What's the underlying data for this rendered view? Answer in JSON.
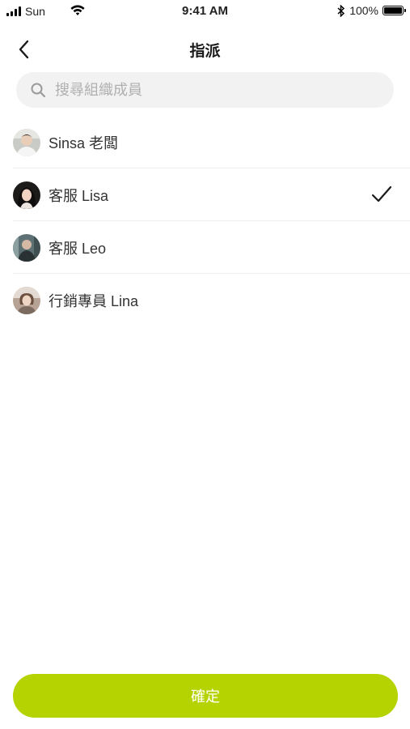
{
  "status_bar": {
    "carrier": "Sun",
    "time": "9:41 AM",
    "battery": "100%",
    "icons": [
      "signal-icon",
      "wifi-icon",
      "bluetooth-icon",
      "battery-icon"
    ]
  },
  "nav": {
    "title": "指派",
    "back_icon": "chevron-left-icon"
  },
  "search": {
    "placeholder": "搜尋組織成員",
    "value": "",
    "icon": "search-icon"
  },
  "members": [
    {
      "name": "Sinsa 老闆",
      "selected": false,
      "avatar": "avatar-photo"
    },
    {
      "name": "客服 Lisa",
      "selected": true,
      "avatar": "avatar-photo"
    },
    {
      "name": "客服 Leo",
      "selected": false,
      "avatar": "avatar-photo"
    },
    {
      "name": "行銷專員 Lina",
      "selected": false,
      "avatar": "avatar-photo"
    }
  ],
  "confirm_label": "確定",
  "colors": {
    "accent": "#b5d300",
    "search_bg": "#f2f2f2",
    "divider": "#eeeeee",
    "text": "#333333",
    "placeholder": "#b0b0b0"
  }
}
